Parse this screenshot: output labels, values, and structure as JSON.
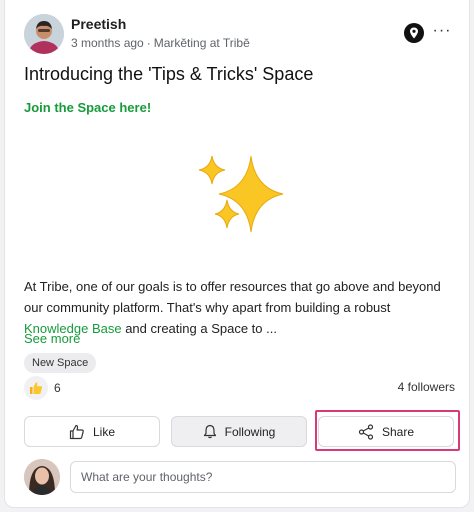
{
  "post": {
    "author": "Preetish",
    "time": "3 months ago",
    "separator": "·",
    "space": "Markĕting at Tribĕ",
    "title": "Introducing the 'Tips & Tricks' Space",
    "join_link": "Join the Space here!",
    "body_before_link": "At Tribe, one of our goals is to offer resources that go above and beyond our community platform. That's why apart from building a robust ",
    "body_link": "Knowledge Base",
    "body_after_link": " and creating a Space to ...",
    "see_more": "See more",
    "tag": "New Space",
    "reaction_count": "6",
    "followers": "4 followers",
    "more_menu": "···"
  },
  "actions": {
    "like": "Like",
    "following": "Following",
    "share": "Share"
  },
  "comment": {
    "placeholder": "What are your thoughts?"
  },
  "colors": {
    "accent_green": "#169c3a",
    "highlight_pink": "#d63b78",
    "sparkle_yellow": "#f9c623"
  },
  "icons": {
    "pin": "location-pin-icon",
    "more": "more-horizontal-icon",
    "sparkles": "sparkles-emoji",
    "reaction": "thumbs-up-emoji",
    "like": "thumbs-up-icon",
    "following": "bell-icon",
    "share": "share-icon"
  }
}
